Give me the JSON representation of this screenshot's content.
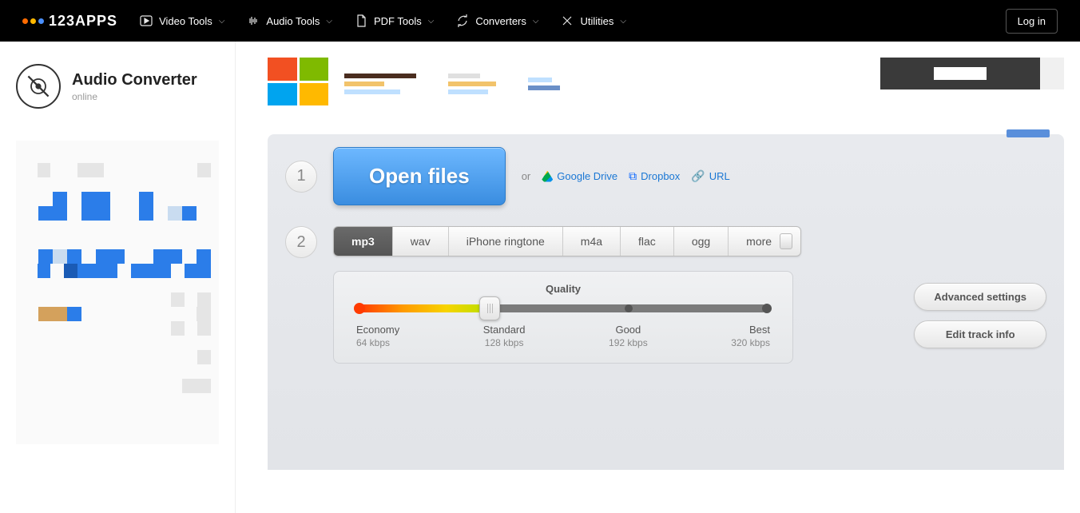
{
  "brand": "123APPS",
  "nav": {
    "video": "Video Tools",
    "audio": "Audio Tools",
    "pdf": "PDF Tools",
    "converters": "Converters",
    "utilities": "Utilities"
  },
  "login": "Log in",
  "app": {
    "title": "Audio Converter",
    "subtitle": "online"
  },
  "step1": {
    "num": "1",
    "open": "Open files",
    "or": "or",
    "gdrive": "Google Drive",
    "dropbox": "Dropbox",
    "url": "URL"
  },
  "step2": {
    "num": "2",
    "tabs": {
      "mp3": "mp3",
      "wav": "wav",
      "iphone": "iPhone ringtone",
      "m4a": "m4a",
      "flac": "flac",
      "ogg": "ogg",
      "more": "more"
    },
    "quality": {
      "title": "Quality",
      "economy": {
        "label": "Economy",
        "rate": "64 kbps"
      },
      "standard": {
        "label": "Standard",
        "rate": "128 kbps"
      },
      "good": {
        "label": "Good",
        "rate": "192 kbps"
      },
      "best": {
        "label": "Best",
        "rate": "320 kbps"
      }
    },
    "advanced": "Advanced settings",
    "edit": "Edit track info"
  }
}
